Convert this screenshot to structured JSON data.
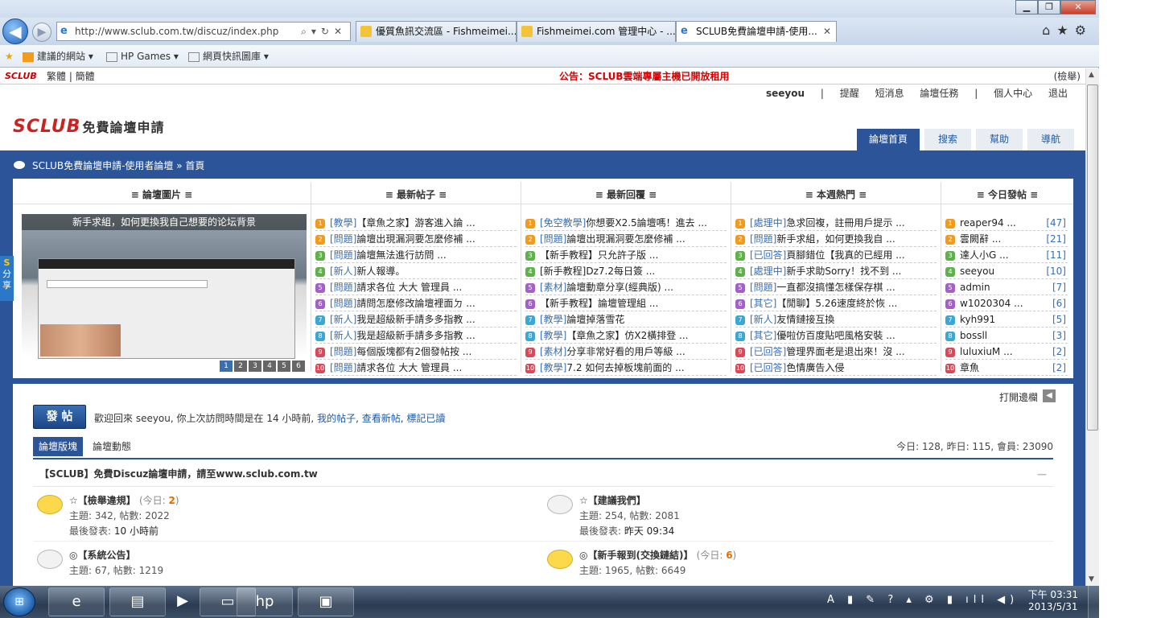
{
  "browser": {
    "window_buttons": {
      "minimize": "▁",
      "maximize": "❐",
      "close": "✕"
    },
    "back_icon": "◀",
    "forward_icon": "▶",
    "address": "http://www.sclub.com.tw/discuz/index.php",
    "address_controls": "⌕▾↻✕",
    "tabs": [
      {
        "label": "優質魚訊交流區 - Fishmeimei...."
      },
      {
        "label": "Fishmeimei.com 管理中心 - ..."
      },
      {
        "label": "SCLUB免費論壇申請-使用..."
      }
    ],
    "tab_close": "✕",
    "right_icons": "⌂★⚙",
    "favorites_bar": {
      "star": "★",
      "items": [
        "建議的網站 ▾",
        "HP Games ▾",
        "網頁快訊圖庫 ▾"
      ]
    }
  },
  "site": {
    "small_logo": "SCLUB",
    "lang": "繁體 | 簡體",
    "notice": "公告：SCLUB雲端專屬主機已開放租用",
    "report": "(檢舉)",
    "logo": "SCLUB",
    "logo_sub": "免費論壇申請",
    "user": {
      "name": "seeyou",
      "sep": "|",
      "links": [
        "提醒",
        "短消息",
        "論壇任務",
        "|",
        "個人中心",
        "退出"
      ]
    },
    "nav_tabs": [
      "論壇首頁",
      "搜索",
      "幫助",
      "導航"
    ],
    "breadcrumb": "SCLUB免費論壇申請-使用者論壇 » 首頁",
    "share": {
      "s": "S",
      "label": "分享"
    }
  },
  "panel": {
    "headers": [
      "≡ 論壇圖片 ≡",
      "≡ 最新帖子 ≡",
      "≡ 最新回覆 ≡",
      "≡ 本週熱門 ≡",
      "≡ 今日發帖 ≡"
    ],
    "picture": {
      "caption": "新手求組，如何更換我自己想要的论坛背景",
      "pages": [
        "1",
        "2",
        "3",
        "4",
        "5",
        "6"
      ]
    },
    "num_colors": [
      "#f29a1c",
      "#f29a1c",
      "#5fb24a",
      "#5fb24a",
      "#a55fc9",
      "#a55fc9",
      "#3aa7d6",
      "#3aa7d6",
      "#d84a5a",
      "#d84a5a"
    ],
    "latest_posts": [
      {
        "cat": "[教學]",
        "title": "【章魚之家】游客進入論 ..."
      },
      {
        "cat": "[問題]",
        "title": "論壇出現漏洞要怎麼修補 ..."
      },
      {
        "cat": "[問題]",
        "title": "論壇無法進行訪問 ..."
      },
      {
        "cat": "[新人]",
        "title": "新人報導。"
      },
      {
        "cat": "[問題]",
        "title": "請求各位 大大 管理員 ..."
      },
      {
        "cat": "[問題]",
        "title": "請問怎麽修改論壇裡面ㄉ ..."
      },
      {
        "cat": "[新人]",
        "title": "我是超級新手請多多指教 ..."
      },
      {
        "cat": "[新人]",
        "title": "我是超級新手請多多指教 ..."
      },
      {
        "cat": "[問題]",
        "title": "每個版塊都有2個發帖按 ..."
      },
      {
        "cat": "[問題]",
        "title": "請求各位 大大 管理員 ..."
      }
    ],
    "latest_replies": [
      {
        "cat": "[免空教學]",
        "title": "你想要X2.5論壇嗎！進去 ..."
      },
      {
        "cat": "[問題]",
        "title": "論壇出現漏洞要怎麼修補 ..."
      },
      {
        "cat": "",
        "title": "【新手教程】只允許子版 ..."
      },
      {
        "cat": "",
        "title": "[新手教程]Dz7.2每日簽 ..."
      },
      {
        "cat": "[素材]",
        "title": "論壇動章分享(經典版) ..."
      },
      {
        "cat": "",
        "title": "【新手教程】論壇管理組 ..."
      },
      {
        "cat": "[教學]",
        "title": "論壇掉落雪花"
      },
      {
        "cat": "[教學]",
        "title": "【章魚之家】仿X2橫排登 ..."
      },
      {
        "cat": "[素材]",
        "title": "分享非常好看的用戶等級 ..."
      },
      {
        "cat": "[教學]",
        "title": "7.2 如何去掉板塊前面的 ..."
      }
    ],
    "weekly_hot": [
      {
        "cat": "[處理中]",
        "title": "急求回複，註冊用戶提示 ..."
      },
      {
        "cat": "[問題]",
        "title": "新手求組，如何更換我自 ..."
      },
      {
        "cat": "[已回答]",
        "title": "頁腳錯位【我真的已經用 ..."
      },
      {
        "cat": "[處理中]",
        "title": "新手求助Sorry！找不到 ..."
      },
      {
        "cat": "[問題]",
        "title": "一直都沒搞懂怎樣保存棋 ..."
      },
      {
        "cat": "[其它]",
        "title": "【閒聊】5.26速度終於恢 ..."
      },
      {
        "cat": "[新人]",
        "title": "友情鏈接互換"
      },
      {
        "cat": "[其它]",
        "title": "優啦仿百度貼吧風格安裝 ..."
      },
      {
        "cat": "[已回答]",
        "title": "管理界面老是退出來！沒 ..."
      },
      {
        "cat": "[已回答]",
        "title": "色情廣告入侵"
      }
    ],
    "today_posters": [
      {
        "name": "reaper94 ...",
        "count": "[47]"
      },
      {
        "name": "雲闕辭 ...",
        "count": "[21]"
      },
      {
        "name": "達人小G ...",
        "count": "[11]"
      },
      {
        "name": "seeyou",
        "count": "[10]"
      },
      {
        "name": "admin",
        "count": "[7]"
      },
      {
        "name": "w1020304 ...",
        "count": "[6]"
      },
      {
        "name": "kyh991",
        "count": "[5]"
      },
      {
        "name": "bossll",
        "count": "[3]"
      },
      {
        "name": "luluxiuM ...",
        "count": "[2]"
      },
      {
        "name": "章魚",
        "count": "[2]"
      }
    ]
  },
  "main": {
    "open_sidebar": "打開邊欄",
    "open_sidebar_icon": "◀",
    "post_button": "發 帖",
    "welcome_prefix": "歡迎回來 seeyou, 你上次訪問時間是在 14 小時前,",
    "welcome_links": [
      "我的帖子",
      "查看新帖",
      "標記已讀"
    ],
    "tabs": [
      "論壇版塊",
      "論壇動態"
    ],
    "stats": "今日: 128, 昨日: 115, 會員: 23090",
    "section_title": "【SCLUB】免費Discuz論壇申請，請至www.sclub.com.tw",
    "section_min": "—",
    "forums": [
      {
        "name": "☆【檢舉違規】",
        "today_label": "(今日: ",
        "today": "2",
        "today_end": ")",
        "stats": "主題: 342, 帖數: 2022",
        "last_label": "最後發表: ",
        "last": "10 小時前"
      },
      {
        "name": "☆【建議我們】",
        "today_label": "",
        "today": "",
        "today_end": "",
        "stats": "主題: 254, 帖數: 2081",
        "last_label": "最後發表: ",
        "last": "昨天 09:34"
      },
      {
        "name": "◎【系統公告】",
        "today_label": "",
        "today": "",
        "today_end": "",
        "stats": "主題: 67, 帖數: 1219",
        "last_label": "",
        "last": ""
      },
      {
        "name": "◎【新手報到(交換鏈結)】",
        "today_label": "(今日: ",
        "today": "6",
        "today_end": ")",
        "stats": "主題: 1965, 帖數: 6649",
        "last_label": "",
        "last": ""
      }
    ]
  },
  "taskbar": {
    "start": "⊞",
    "clock_time": "下午 03:31",
    "clock_date": "2013/5/31",
    "tray": "A ▮ ✎ ? ▴ ⚙ ▮ ıll ◀)"
  }
}
